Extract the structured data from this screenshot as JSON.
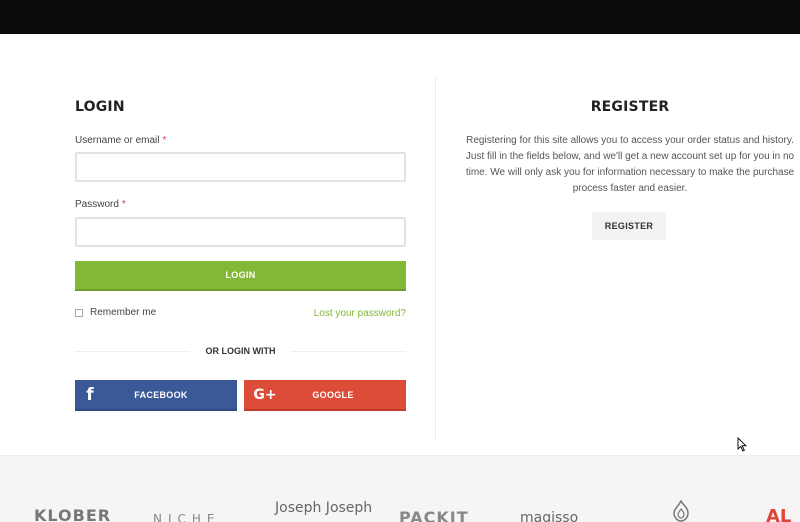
{
  "login": {
    "title": "LOGIN",
    "username_label": "Username or email",
    "username_value": "",
    "password_label": "Password",
    "password_value": "",
    "required_mark": "*",
    "submit_label": "LOGIN",
    "remember_label": "Remember me",
    "lost_password_label": "Lost your password?",
    "or_label": "OR LOGIN WITH",
    "facebook_label": "FACEBOOK",
    "google_label": "GOOGLE",
    "facebook_icon": "f",
    "google_icon": "G+"
  },
  "register": {
    "title": "REGISTER",
    "description": "Registering for this site allows you to access your order status and history. Just fill in the fields below, and we'll get a new account set up for you in no time. We will only ask you for information necessary to make the purchase process faster and easier.",
    "button_label": "REGISTER"
  },
  "brands": [
    "KLOBER",
    "NICHE",
    "Joseph Joseph",
    "PACKIT",
    "magisso",
    "AL"
  ],
  "colors": {
    "accent": "#83b735",
    "facebook": "#3b5998",
    "google": "#dd4b39",
    "topbar": "#0b0b0b"
  }
}
